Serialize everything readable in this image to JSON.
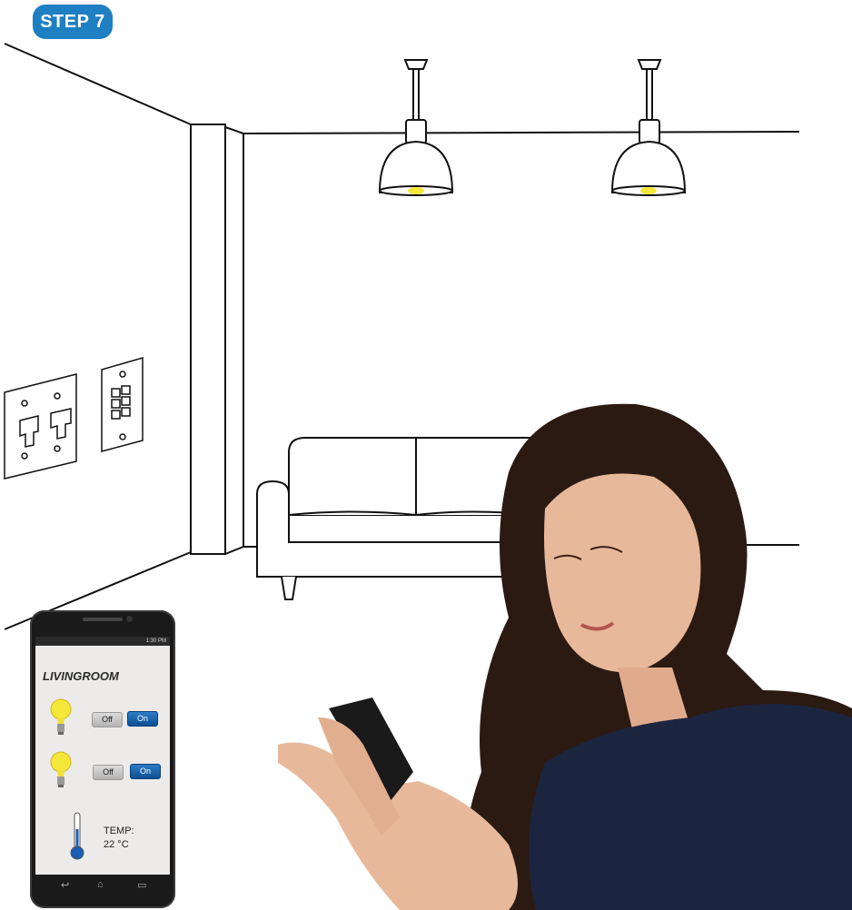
{
  "step": {
    "label": "STEP 7"
  },
  "phone": {
    "status_time": "1:30 PM",
    "room_title": "LIVINGROOM",
    "lights": [
      {
        "off_label": "Off",
        "on_label": "On",
        "state": "On"
      },
      {
        "off_label": "Off",
        "on_label": "On",
        "state": "On"
      }
    ],
    "temp_label": "TEMP:",
    "temp_value": "22 °C",
    "nav": {
      "back_icon": "back-icon",
      "home_icon": "home-icon",
      "menu_icon": "menu-icon"
    }
  },
  "colors": {
    "accent": "#1e7fc2",
    "on_button": "#1a66b0",
    "bulb_glow": "#f5e63a",
    "woman_top": "#1c2540",
    "hair": "#2b1a12",
    "skin": "#e8b89a"
  }
}
